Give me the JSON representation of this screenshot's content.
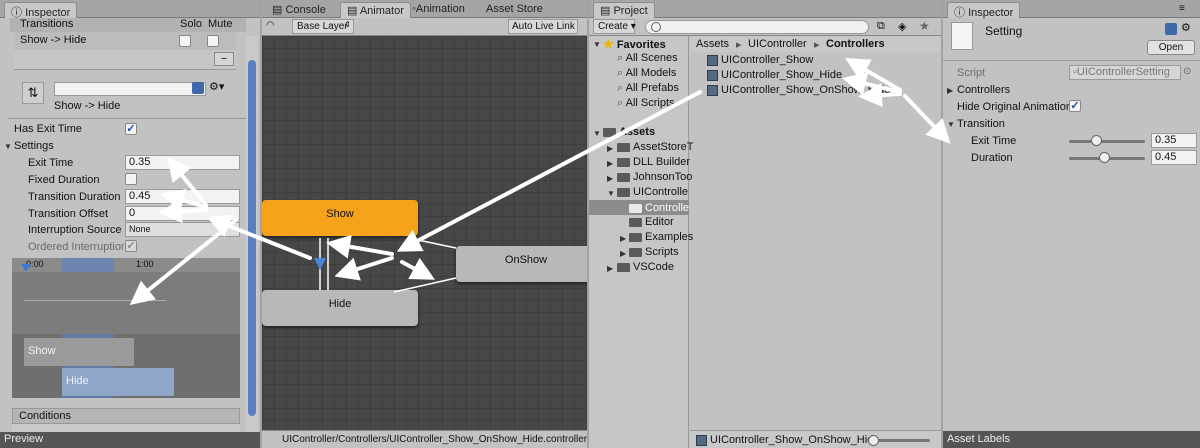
{
  "left_inspector": {
    "tab": "Inspector",
    "transitions_header": "Transitions",
    "solo": "Solo",
    "mute": "Mute",
    "transition_row": "Show -> Hide",
    "minus": "−",
    "transition_name": "Show -> Hide",
    "has_exit_time_label": "Has Exit Time",
    "settings_label": "Settings",
    "exit_time_label": "Exit Time",
    "exit_time_value": "0.35",
    "fixed_duration_label": "Fixed Duration",
    "transition_duration_label": "Transition Duration",
    "transition_duration_value": "0.45",
    "transition_offset_label": "Transition Offset",
    "transition_offset_value": "0",
    "interruption_source_label": "Interruption Source",
    "interruption_source_value": "None",
    "ordered_interruption_label": "Ordered Interruption",
    "timeline_start": "0:00",
    "timeline_mid": "1:00",
    "timeline_show": "Show",
    "timeline_hide": "Hide",
    "conditions_label": "Conditions",
    "preview_label": "Preview"
  },
  "animator": {
    "tabs": [
      "Console",
      "Animator",
      "Animation",
      "Asset Store"
    ],
    "layer_dropdown": "Base Layer",
    "auto_live_link": "Auto Live Link",
    "node_show": "Show",
    "node_hide": "Hide",
    "node_onshow": "OnShow",
    "footer_path": "UIController/Controllers/UIController_Show_OnShow_Hide.controller",
    "colors": {
      "show_node": "#f7a21b",
      "default_node": "#b8b8b8",
      "canvas": "#474747"
    }
  },
  "project": {
    "tab": "Project",
    "create": "Create",
    "favorites": "Favorites",
    "favorites_items": [
      "All Scenes",
      "All Models",
      "All Prefabs",
      "All Scripts"
    ],
    "assets": "Assets",
    "assets_children": [
      "AssetStoreT",
      "DLL Builder",
      "JohnsonToo",
      "UIControlle"
    ],
    "uicontroller_children": [
      "Controlle",
      "Editor",
      "Examples",
      "Scripts"
    ],
    "vscode": "VSCode",
    "breadcrumb": [
      "Assets",
      "UIController",
      "Controllers"
    ],
    "files": [
      "UIController_Show",
      "UIController_Show_Hide",
      "UIController_Show_OnShow_Hide"
    ],
    "footer_file": "UIController_Show_OnShow_Hid"
  },
  "right_inspector": {
    "tab": "Inspector",
    "asset_name": "Setting",
    "open_button": "Open",
    "script_label": "Script",
    "script_value": "UIControllerSetting",
    "controllers_label": "Controllers",
    "hide_original_label": "Hide Original Animation",
    "transition_label": "Transition",
    "exit_time_label": "Exit Time",
    "exit_time_value": "0.35",
    "duration_label": "Duration",
    "duration_value": "0.45",
    "asset_labels": "Asset Labels"
  }
}
